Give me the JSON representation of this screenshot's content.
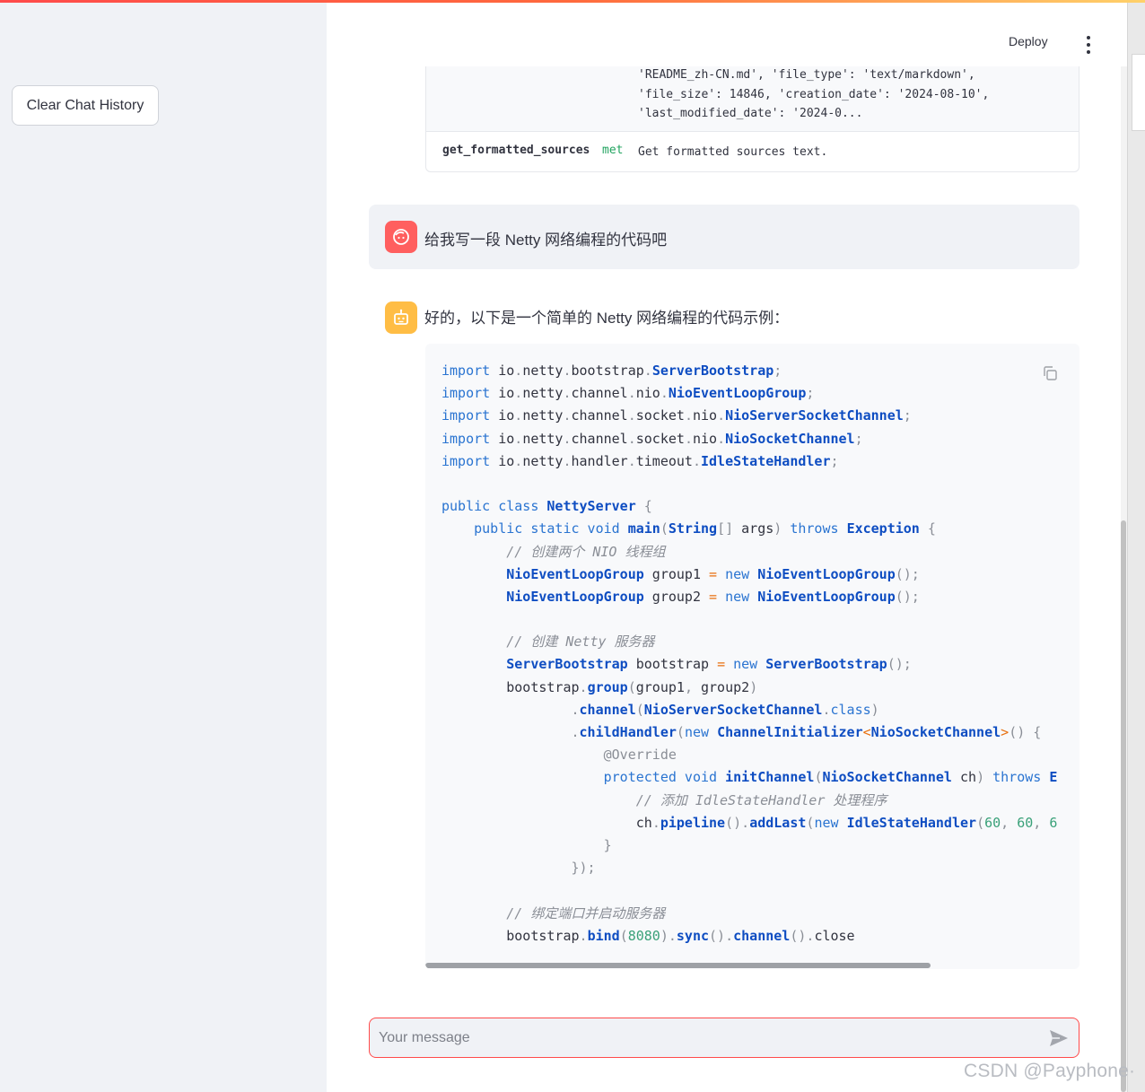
{
  "sidebar": {
    "clear_label": "Clear Chat History"
  },
  "header": {
    "deploy_label": "Deploy",
    "menu_icon": "kebab-menu-icon"
  },
  "sources_table": {
    "meta_lines": [
      "'README_zh-CN.md', 'file_type': 'text/markdown',",
      "'file_size': 14846, 'creation_date': '2024-08-10',",
      "'last_modified_date': '2024-0..."
    ],
    "row_key": "get_formatted_sources",
    "row_tag": "met",
    "row_desc": "Get formatted sources text."
  },
  "messages": {
    "user_text": "给我写一段 Netty 网络编程的代码吧",
    "assistant_text": "好的，以下是一个简单的 Netty 网络编程的代码示例："
  },
  "code": {
    "language": "java",
    "copy_icon": "copy-icon",
    "lines": [
      [
        [
          "kw",
          "import"
        ],
        [
          "t",
          " io"
        ],
        [
          "pn",
          "."
        ],
        [
          "t",
          "netty"
        ],
        [
          "pn",
          "."
        ],
        [
          "t",
          "bootstrap"
        ],
        [
          "pn",
          "."
        ],
        [
          "cls",
          "ServerBootstrap"
        ],
        [
          "pn",
          ";"
        ]
      ],
      [
        [
          "kw",
          "import"
        ],
        [
          "t",
          " io"
        ],
        [
          "pn",
          "."
        ],
        [
          "t",
          "netty"
        ],
        [
          "pn",
          "."
        ],
        [
          "t",
          "channel"
        ],
        [
          "pn",
          "."
        ],
        [
          "t",
          "nio"
        ],
        [
          "pn",
          "."
        ],
        [
          "cls",
          "NioEventLoopGroup"
        ],
        [
          "pn",
          ";"
        ]
      ],
      [
        [
          "kw",
          "import"
        ],
        [
          "t",
          " io"
        ],
        [
          "pn",
          "."
        ],
        [
          "t",
          "netty"
        ],
        [
          "pn",
          "."
        ],
        [
          "t",
          "channel"
        ],
        [
          "pn",
          "."
        ],
        [
          "t",
          "socket"
        ],
        [
          "pn",
          "."
        ],
        [
          "t",
          "nio"
        ],
        [
          "pn",
          "."
        ],
        [
          "cls",
          "NioServerSocketChannel"
        ],
        [
          "pn",
          ";"
        ]
      ],
      [
        [
          "kw",
          "import"
        ],
        [
          "t",
          " io"
        ],
        [
          "pn",
          "."
        ],
        [
          "t",
          "netty"
        ],
        [
          "pn",
          "."
        ],
        [
          "t",
          "channel"
        ],
        [
          "pn",
          "."
        ],
        [
          "t",
          "socket"
        ],
        [
          "pn",
          "."
        ],
        [
          "t",
          "nio"
        ],
        [
          "pn",
          "."
        ],
        [
          "cls",
          "NioSocketChannel"
        ],
        [
          "pn",
          ";"
        ]
      ],
      [
        [
          "kw",
          "import"
        ],
        [
          "t",
          " io"
        ],
        [
          "pn",
          "."
        ],
        [
          "t",
          "netty"
        ],
        [
          "pn",
          "."
        ],
        [
          "t",
          "handler"
        ],
        [
          "pn",
          "."
        ],
        [
          "t",
          "timeout"
        ],
        [
          "pn",
          "."
        ],
        [
          "cls",
          "IdleStateHandler"
        ],
        [
          "pn",
          ";"
        ]
      ],
      [],
      [
        [
          "kw",
          "public class"
        ],
        [
          "t",
          " "
        ],
        [
          "cls",
          "NettyServer"
        ],
        [
          "t",
          " "
        ],
        [
          "pn",
          "{"
        ]
      ],
      [
        [
          "t",
          "    "
        ],
        [
          "kw",
          "public static void"
        ],
        [
          "t",
          " "
        ],
        [
          "cls",
          "main"
        ],
        [
          "pn",
          "("
        ],
        [
          "cls",
          "String"
        ],
        [
          "pn",
          "[]"
        ],
        [
          "t",
          " args"
        ],
        [
          "pn",
          ")"
        ],
        [
          "t",
          " "
        ],
        [
          "kw",
          "throws"
        ],
        [
          "t",
          " "
        ],
        [
          "cls",
          "Exception"
        ],
        [
          "t",
          " "
        ],
        [
          "pn",
          "{"
        ]
      ],
      [
        [
          "t",
          "        "
        ],
        [
          "cm",
          "// 创建两个 NIO 线程组"
        ]
      ],
      [
        [
          "t",
          "        "
        ],
        [
          "cls",
          "NioEventLoopGroup"
        ],
        [
          "t",
          " group1 "
        ],
        [
          "op",
          "="
        ],
        [
          "t",
          " "
        ],
        [
          "kw",
          "new"
        ],
        [
          "t",
          " "
        ],
        [
          "cls",
          "NioEventLoopGroup"
        ],
        [
          "pn",
          "();"
        ]
      ],
      [
        [
          "t",
          "        "
        ],
        [
          "cls",
          "NioEventLoopGroup"
        ],
        [
          "t",
          " group2 "
        ],
        [
          "op",
          "="
        ],
        [
          "t",
          " "
        ],
        [
          "kw",
          "new"
        ],
        [
          "t",
          " "
        ],
        [
          "cls",
          "NioEventLoopGroup"
        ],
        [
          "pn",
          "();"
        ]
      ],
      [],
      [
        [
          "t",
          "        "
        ],
        [
          "cm",
          "// 创建 Netty 服务器"
        ]
      ],
      [
        [
          "t",
          "        "
        ],
        [
          "cls",
          "ServerBootstrap"
        ],
        [
          "t",
          " bootstrap "
        ],
        [
          "op",
          "="
        ],
        [
          "t",
          " "
        ],
        [
          "kw",
          "new"
        ],
        [
          "t",
          " "
        ],
        [
          "cls",
          "ServerBootstrap"
        ],
        [
          "pn",
          "();"
        ]
      ],
      [
        [
          "t",
          "        bootstrap"
        ],
        [
          "pn",
          "."
        ],
        [
          "cls",
          "group"
        ],
        [
          "pn",
          "("
        ],
        [
          "t",
          "group1"
        ],
        [
          "pn",
          ","
        ],
        [
          "t",
          " group2"
        ],
        [
          "pn",
          ")"
        ]
      ],
      [
        [
          "t",
          "                "
        ],
        [
          "pn",
          "."
        ],
        [
          "cls",
          "channel"
        ],
        [
          "pn",
          "("
        ],
        [
          "cls",
          "NioServerSocketChannel"
        ],
        [
          "pn",
          "."
        ],
        [
          "kw",
          "class"
        ],
        [
          "pn",
          ")"
        ]
      ],
      [
        [
          "t",
          "                "
        ],
        [
          "pn",
          "."
        ],
        [
          "cls",
          "childHandler"
        ],
        [
          "pn",
          "("
        ],
        [
          "kw",
          "new"
        ],
        [
          "t",
          " "
        ],
        [
          "cls",
          "ChannelInitializer"
        ],
        [
          "op",
          "<"
        ],
        [
          "cls",
          "NioSocketChannel"
        ],
        [
          "op",
          ">"
        ],
        [
          "pn",
          "()"
        ],
        [
          "t",
          " "
        ],
        [
          "pn",
          "{"
        ]
      ],
      [
        [
          "t",
          "                    "
        ],
        [
          "pn",
          "@Override"
        ]
      ],
      [
        [
          "t",
          "                    "
        ],
        [
          "kw",
          "protected void"
        ],
        [
          "t",
          " "
        ],
        [
          "cls",
          "initChannel"
        ],
        [
          "pn",
          "("
        ],
        [
          "cls",
          "NioSocketChannel"
        ],
        [
          "t",
          " ch"
        ],
        [
          "pn",
          ")"
        ],
        [
          "t",
          " "
        ],
        [
          "kw",
          "throws"
        ],
        [
          "t",
          " "
        ],
        [
          "cls",
          "E"
        ]
      ],
      [
        [
          "t",
          "                        "
        ],
        [
          "cm",
          "// 添加 IdleStateHandler 处理程序"
        ]
      ],
      [
        [
          "t",
          "                        ch"
        ],
        [
          "pn",
          "."
        ],
        [
          "cls",
          "pipeline"
        ],
        [
          "pn",
          "()."
        ],
        [
          "cls",
          "addLast"
        ],
        [
          "pn",
          "("
        ],
        [
          "kw",
          "new"
        ],
        [
          "t",
          " "
        ],
        [
          "cls",
          "IdleStateHandler"
        ],
        [
          "pn",
          "("
        ],
        [
          "num",
          "60"
        ],
        [
          "pn",
          ","
        ],
        [
          "t",
          " "
        ],
        [
          "num",
          "60"
        ],
        [
          "pn",
          ","
        ],
        [
          "t",
          " "
        ],
        [
          "num",
          "6"
        ]
      ],
      [
        [
          "t",
          "                    "
        ],
        [
          "pn",
          "}"
        ]
      ],
      [
        [
          "t",
          "                "
        ],
        [
          "pn",
          "});"
        ]
      ],
      [],
      [
        [
          "t",
          "        "
        ],
        [
          "cm",
          "// 绑定端口并启动服务器"
        ]
      ],
      [
        [
          "t",
          "        bootstrap"
        ],
        [
          "pn",
          "."
        ],
        [
          "cls",
          "bind"
        ],
        [
          "pn",
          "("
        ],
        [
          "num",
          "8080"
        ],
        [
          "pn",
          ")."
        ],
        [
          "cls",
          "sync"
        ],
        [
          "pn",
          "()."
        ],
        [
          "cls",
          "channel"
        ],
        [
          "pn",
          "()."
        ],
        [
          "t",
          "close"
        ]
      ]
    ]
  },
  "input": {
    "placeholder": "Your message",
    "send_icon": "send-icon"
  },
  "watermark": "CSDN @Payphone·"
}
